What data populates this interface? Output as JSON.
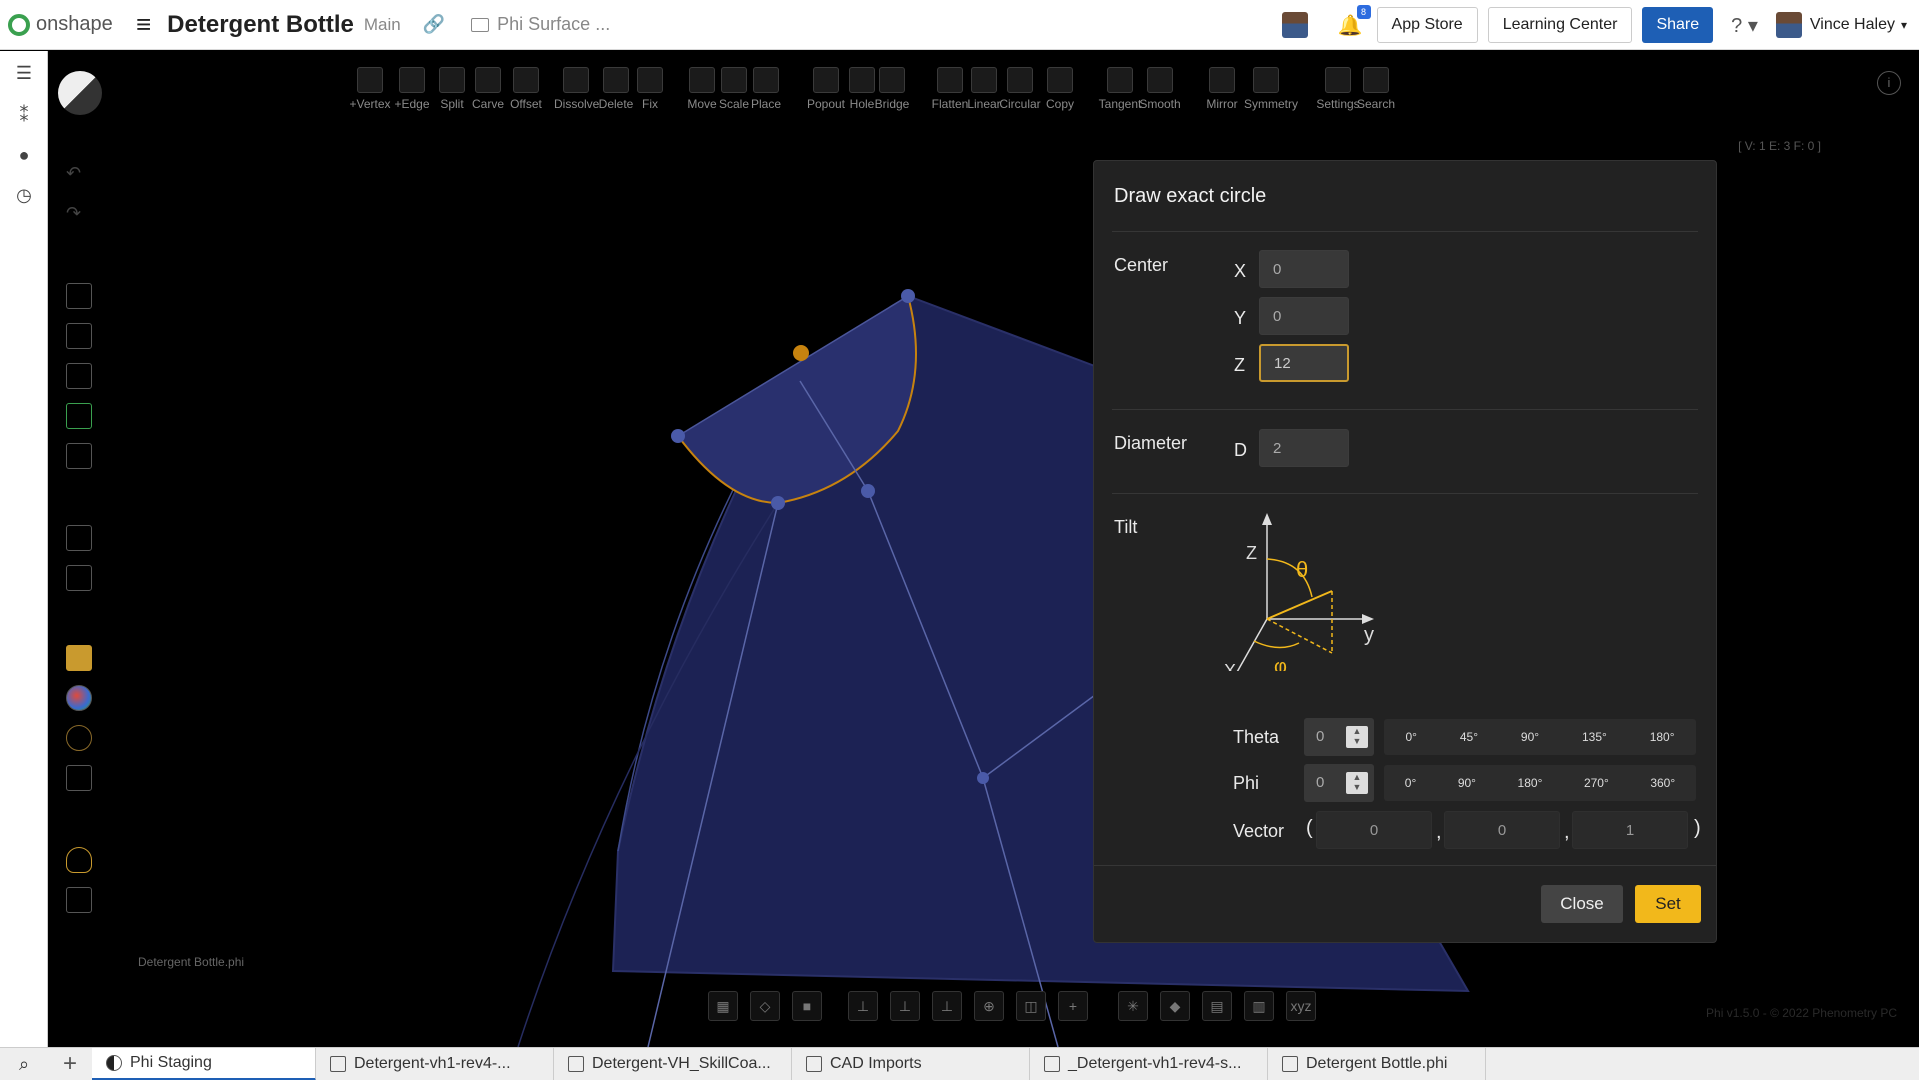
{
  "app": {
    "logo_text": "onshape",
    "doc_title": "Detergent Bottle",
    "branch": "Main",
    "breadcrumb_folder": "Phi Surface ..."
  },
  "topbar": {
    "notification_count": "8",
    "app_store": "App Store",
    "learning_center": "Learning Center",
    "share": "Share",
    "help": "?",
    "user_name": "Vince Haley"
  },
  "toolbar": {
    "tools": [
      {
        "label": "+Vertex",
        "icon": "vertex-icon"
      },
      {
        "label": "+Edge",
        "icon": "edge-icon"
      },
      {
        "label": "Split",
        "icon": "split-icon"
      },
      {
        "label": "Carve",
        "icon": "carve-icon"
      },
      {
        "label": "Offset",
        "icon": "offset-icon"
      },
      {
        "label": "Dissolve",
        "icon": "dissolve-icon"
      },
      {
        "label": "Delete",
        "icon": "delete-icon"
      },
      {
        "label": "Fix",
        "icon": "anchor-icon"
      },
      {
        "label": "Move",
        "icon": "move-icon"
      },
      {
        "label": "Scale",
        "icon": "scale-icon"
      },
      {
        "label": "Place",
        "icon": "place-icon"
      },
      {
        "label": "Popout",
        "icon": "popout-icon"
      },
      {
        "label": "Hole",
        "icon": "hole-icon"
      },
      {
        "label": "Bridge",
        "icon": "bridge-icon"
      },
      {
        "label": "Flatten",
        "icon": "flatten-icon"
      },
      {
        "label": "Linear",
        "icon": "linear-icon"
      },
      {
        "label": "Circular",
        "icon": "circular-icon"
      },
      {
        "label": "Copy",
        "icon": "copy-icon"
      },
      {
        "label": "Tangent",
        "icon": "tangent-icon"
      },
      {
        "label": "Smooth",
        "icon": "smooth-icon"
      },
      {
        "label": "Mirror",
        "icon": "mirror-icon"
      },
      {
        "label": "Symmetry",
        "icon": "symmetry-icon"
      },
      {
        "label": "Settings",
        "icon": "gear-icon"
      },
      {
        "label": "Search",
        "icon": "search-icon"
      }
    ]
  },
  "viewport": {
    "stats": "[ V: 1 E: 3 F: 0 ]",
    "filename": "Detergent Bottle.phi",
    "version": "Phi v1.5.0 - © 2022 Phenometry PC"
  },
  "dialog": {
    "title": "Draw exact circle",
    "center_label": "Center",
    "x_label": "X",
    "y_label": "Y",
    "z_label": "Z",
    "x_value": "0",
    "y_value": "0",
    "z_value": "12",
    "diameter_label": "Diameter",
    "d_label": "D",
    "d_value": "2",
    "tilt_label": "Tilt",
    "diagram": {
      "z": "Z",
      "y": "y",
      "x": "X",
      "theta": "θ",
      "phi": "φ"
    },
    "theta_label": "Theta",
    "theta_value": "0",
    "theta_presets": [
      "0°",
      "45°",
      "90°",
      "135°",
      "180°"
    ],
    "phi_label": "Phi",
    "phi_value": "0",
    "phi_presets": [
      "0°",
      "90°",
      "180°",
      "270°",
      "360°"
    ],
    "vector_label": "Vector",
    "vector": [
      "0",
      "0",
      "1"
    ],
    "open_paren": "(",
    "close_paren": ")",
    "comma": ",",
    "close_button": "Close",
    "set_button": "Set"
  },
  "tabs": [
    {
      "label": "Phi Staging",
      "icon": "phi-app-icon",
      "active": true
    },
    {
      "label": "Detergent-vh1-rev4-...",
      "icon": "assembly-icon",
      "active": false
    },
    {
      "label": "Detergent-VH_SkillCoa...",
      "icon": "folder-icon",
      "active": false
    },
    {
      "label": "CAD Imports",
      "icon": "folder-icon",
      "active": false
    },
    {
      "label": "_Detergent-vh1-rev4-s...",
      "icon": "document-icon",
      "active": false
    },
    {
      "label": "Detergent Bottle.phi",
      "icon": "document-icon",
      "active": false
    }
  ],
  "colors": {
    "accent_yellow": "#f2b81b",
    "share_blue": "#1e5fb5",
    "surface_blue": "#1c2254",
    "vertex_orange": "#c7830f"
  }
}
